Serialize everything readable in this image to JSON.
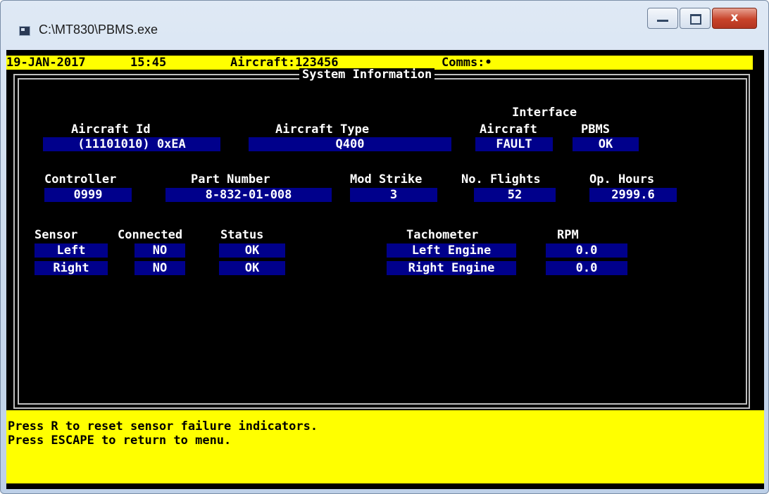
{
  "window": {
    "title": "C:\\MT830\\PBMS.exe",
    "close_glyph": "x"
  },
  "status": {
    "date": "19-JAN-2017",
    "time": "15:45",
    "aircraft": "Aircraft:123456",
    "comms": "Comms:•"
  },
  "panel": {
    "title": "System Information"
  },
  "identity": {
    "aircraft_id_label": "Aircraft Id",
    "aircraft_id_value": "(11101010) 0xEA",
    "aircraft_type_label": "Aircraft Type",
    "aircraft_type_value": "Q400",
    "interface_label": "Interface",
    "interface_aircraft_label": "Aircraft",
    "interface_aircraft_value": "FAULT",
    "interface_pbms_label": "PBMS",
    "interface_pbms_value": "OK"
  },
  "controller": {
    "controller_label": "Controller",
    "controller_value": "0999",
    "part_number_label": "Part Number",
    "part_number_value": "8-832-01-008",
    "mod_strike_label": "Mod Strike",
    "mod_strike_value": "3",
    "flights_label": "No. Flights",
    "flights_value": "52",
    "hours_label": "Op. Hours",
    "hours_value": "2999.6"
  },
  "sensors": {
    "headers": {
      "sensor": "Sensor",
      "connected": "Connected",
      "status": "Status"
    },
    "rows": [
      {
        "sensor": "Left",
        "connected": "NO",
        "status": "OK"
      },
      {
        "sensor": "Right",
        "connected": "NO",
        "status": "OK"
      }
    ]
  },
  "tachometer": {
    "headers": {
      "name": "Tachometer",
      "rpm": "RPM"
    },
    "rows": [
      {
        "name": "Left Engine",
        "rpm": "0.0"
      },
      {
        "name": "Right Engine",
        "rpm": "0.0"
      }
    ]
  },
  "help": {
    "line1": "Press R to reset sensor failure indicators.",
    "line2": "Press ESCAPE to return to menu."
  },
  "colors": {
    "status_bar": "#ffff00",
    "field_bg": "#00008b",
    "console_bg": "#000000",
    "close_button": "#c8432a"
  }
}
